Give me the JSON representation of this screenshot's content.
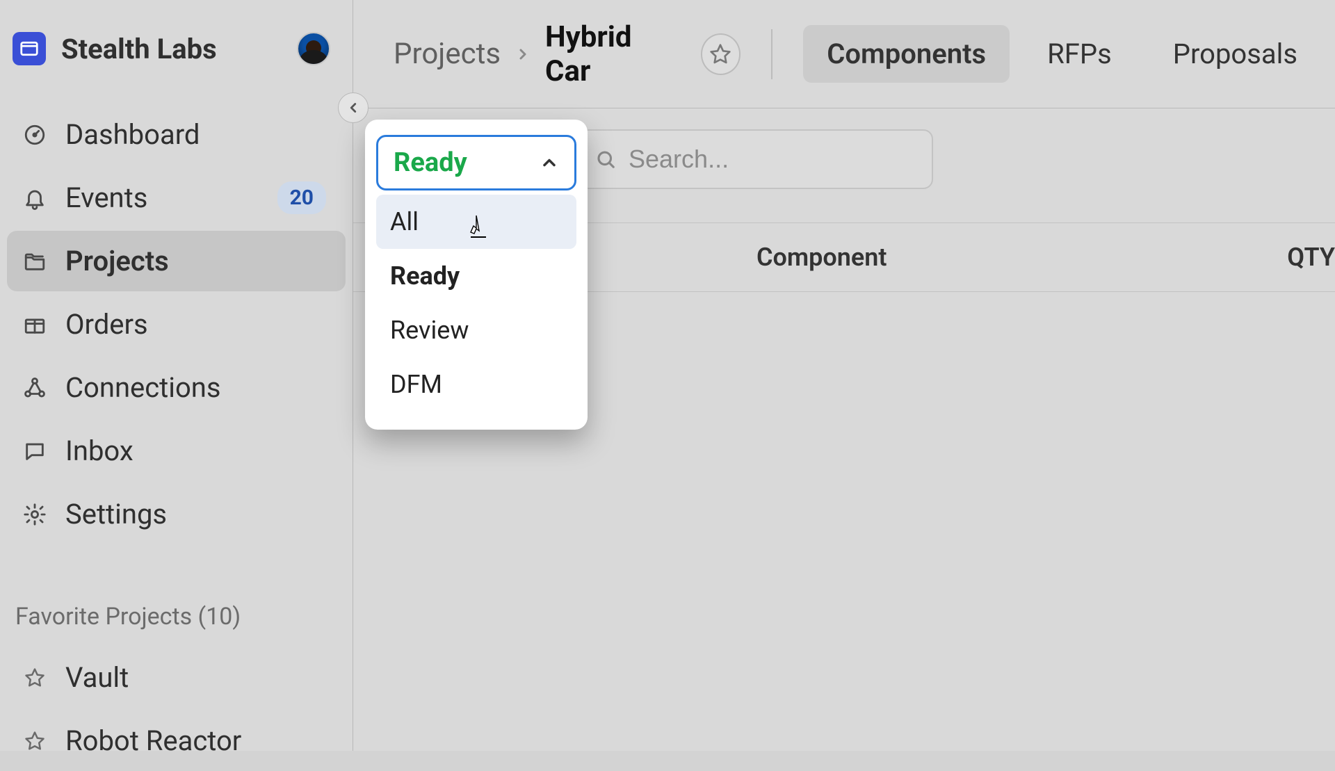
{
  "brand": {
    "name": "Stealth Labs"
  },
  "sidebar": {
    "items": [
      {
        "icon": "gauge-icon",
        "label": "Dashboard",
        "badge": null
      },
      {
        "icon": "bell-icon",
        "label": "Events",
        "badge": "20"
      },
      {
        "icon": "folders-icon",
        "label": "Projects",
        "badge": null,
        "active": true
      },
      {
        "icon": "package-icon",
        "label": "Orders",
        "badge": null
      },
      {
        "icon": "network-icon",
        "label": "Connections",
        "badge": null
      },
      {
        "icon": "chat-icon",
        "label": "Inbox",
        "badge": null
      },
      {
        "icon": "gear-icon",
        "label": "Settings",
        "badge": null
      }
    ],
    "favorites_heading": "Favorite Projects (10)",
    "favorites": [
      {
        "label": "Vault"
      },
      {
        "label": "Robot Reactor"
      }
    ]
  },
  "header": {
    "breadcrumb_root": "Projects",
    "breadcrumb_current": "Hybrid Car",
    "tabs": [
      {
        "label": "Components",
        "active": true
      },
      {
        "label": "RFPs"
      },
      {
        "label": "Proposals"
      }
    ]
  },
  "toolbar": {
    "search_placeholder": "Search..."
  },
  "table": {
    "columns": [
      {
        "label": "Component"
      },
      {
        "label": "QTY"
      }
    ]
  },
  "filter_dropdown": {
    "selected": "Ready",
    "options": [
      {
        "label": "All",
        "hover": true,
        "selected": false
      },
      {
        "label": "Ready",
        "hover": false,
        "selected": true
      },
      {
        "label": "Review",
        "hover": false,
        "selected": false
      },
      {
        "label": "DFM",
        "hover": false,
        "selected": false
      }
    ]
  }
}
